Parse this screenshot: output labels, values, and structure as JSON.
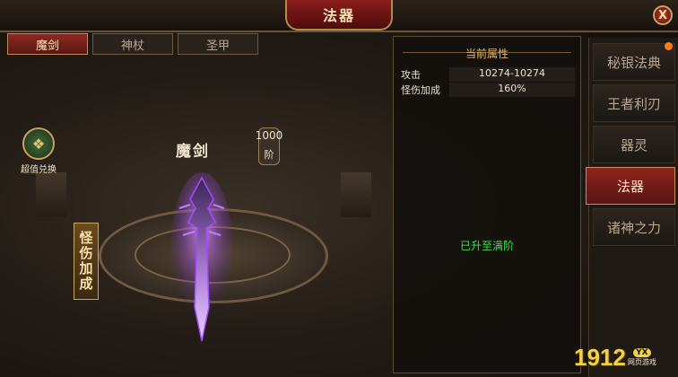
{
  "window": {
    "title": "法器",
    "close_label": "X"
  },
  "tabs": [
    {
      "label": "魔剑",
      "active": true
    },
    {
      "label": "神杖",
      "active": false
    },
    {
      "label": "圣甲",
      "active": false
    }
  ],
  "scene": {
    "exchange_label": "超值兑换",
    "weapon_name": "魔剑",
    "stage_number": "1000",
    "stage_unit": "阶",
    "side_label": "怪伤加成"
  },
  "attributes": {
    "header": "当前属性",
    "rows": [
      {
        "name": "攻击",
        "value": "10274-10274"
      },
      {
        "name": "怪伤加成",
        "value": "160%"
      }
    ],
    "max_text": "已升至满阶"
  },
  "nav": [
    {
      "label": "秘银法典",
      "active": false
    },
    {
      "label": "王者利刃",
      "active": false
    },
    {
      "label": "器灵",
      "active": false
    },
    {
      "label": "法器",
      "active": true
    },
    {
      "label": "诸神之力",
      "active": false
    }
  ],
  "watermark": {
    "number": "1912",
    "badge": "YX",
    "subtitle": "网页游戏"
  },
  "colors": {
    "accent_red": "#8c2a22",
    "gold": "#c9a45e",
    "max_green": "#3fe04b",
    "sword_purple": "#a24bff"
  }
}
